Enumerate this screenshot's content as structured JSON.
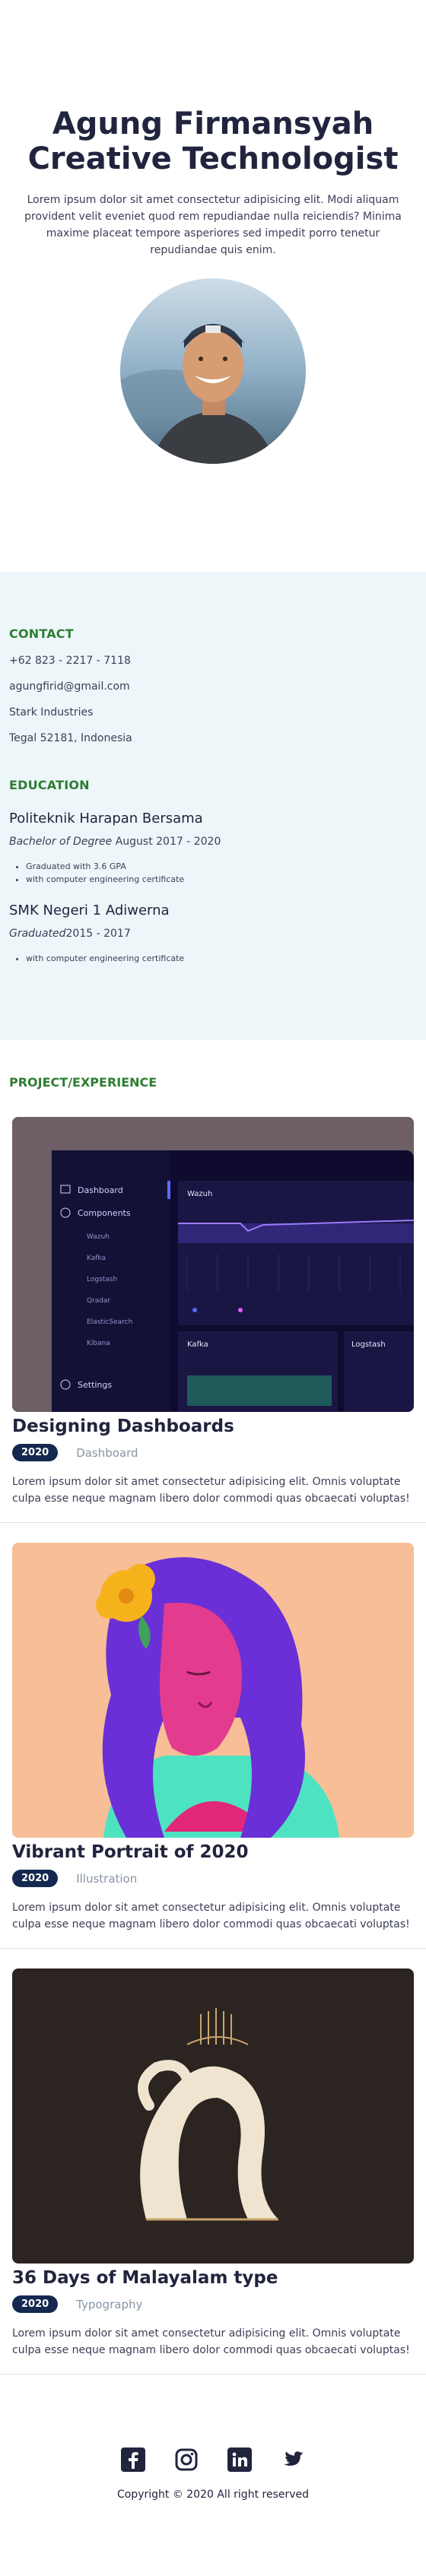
{
  "hero": {
    "name": "Agung Firmansyah",
    "role": "Creative Technologist",
    "intro": "Lorem ipsum dolor sit amet consectetur adipisicing elit. Modi aliquam provident velit eveniet quod rem repudiandae nulla reiciendis? Minima maxime placeat tempore asperiores sed impedit porro tenetur repudiandae quis enim."
  },
  "contact": {
    "heading": "CONTACT",
    "phone": "+62 823 - 2217 - 7118",
    "email": "agungfirid@gmail.com",
    "company": "Stark Industries",
    "address": "Tegal 52181, Indonesia"
  },
  "education": {
    "heading": "EDUCATION",
    "schools": [
      {
        "name": "Politeknik Harapan Bersama",
        "degree": "Bachelor of Degree",
        "period": "August 2017 - 2020",
        "notes": [
          "Graduated with 3.6 GPA",
          "with computer engineering certificate"
        ]
      },
      {
        "name": "SMK Negeri 1 Adiwerna",
        "degree": "Graduated",
        "period": "2015 - 2017",
        "notes": [
          "with computer engineering certificate"
        ]
      }
    ]
  },
  "projects": {
    "heading": "PROJECT/EXPERIENCE",
    "items": [
      {
        "title": "Designing Dashboards",
        "year": "2020",
        "category": "Dashboard",
        "desc": "Lorem ipsum dolor sit amet consectetur adipisicing elit. Omnis voluptate culpa esse neque magnam libero dolor commodi quas obcaecati voluptas!"
      },
      {
        "title": "Vibrant Portrait of 2020",
        "year": "2020",
        "category": "Illustration",
        "desc": "Lorem ipsum dolor sit amet consectetur adipisicing elit. Omnis voluptate culpa esse neque magnam libero dolor commodi quas obcaecati voluptas!"
      },
      {
        "title": "36 Days of Malayalam type",
        "year": "2020",
        "category": "Typography",
        "desc": "Lorem ipsum dolor sit amet consectetur adipisicing elit. Omnis voluptate culpa esse neque magnam libero dolor commodi quas obcaecati voluptas!"
      }
    ]
  },
  "dashboard_mock": {
    "menu": [
      "Dashboard",
      "Components",
      "Wazuh",
      "Kafka",
      "Logstash",
      "Qradar",
      "ElasticSearch",
      "Kibana",
      "Settings"
    ],
    "panel1": "Wazuh",
    "panel2": "Kafka",
    "panel3": "Logstash"
  },
  "footer": {
    "icons": [
      "facebook-icon",
      "instagram-icon",
      "linkedin-icon",
      "twitter-icon"
    ],
    "copyright": "Copyright © 2020 All right reserved"
  },
  "colors": {
    "navy": "#21243d",
    "accent_green": "#2e7d32",
    "badge": "#142850",
    "info_bg": "#edf7fa"
  }
}
